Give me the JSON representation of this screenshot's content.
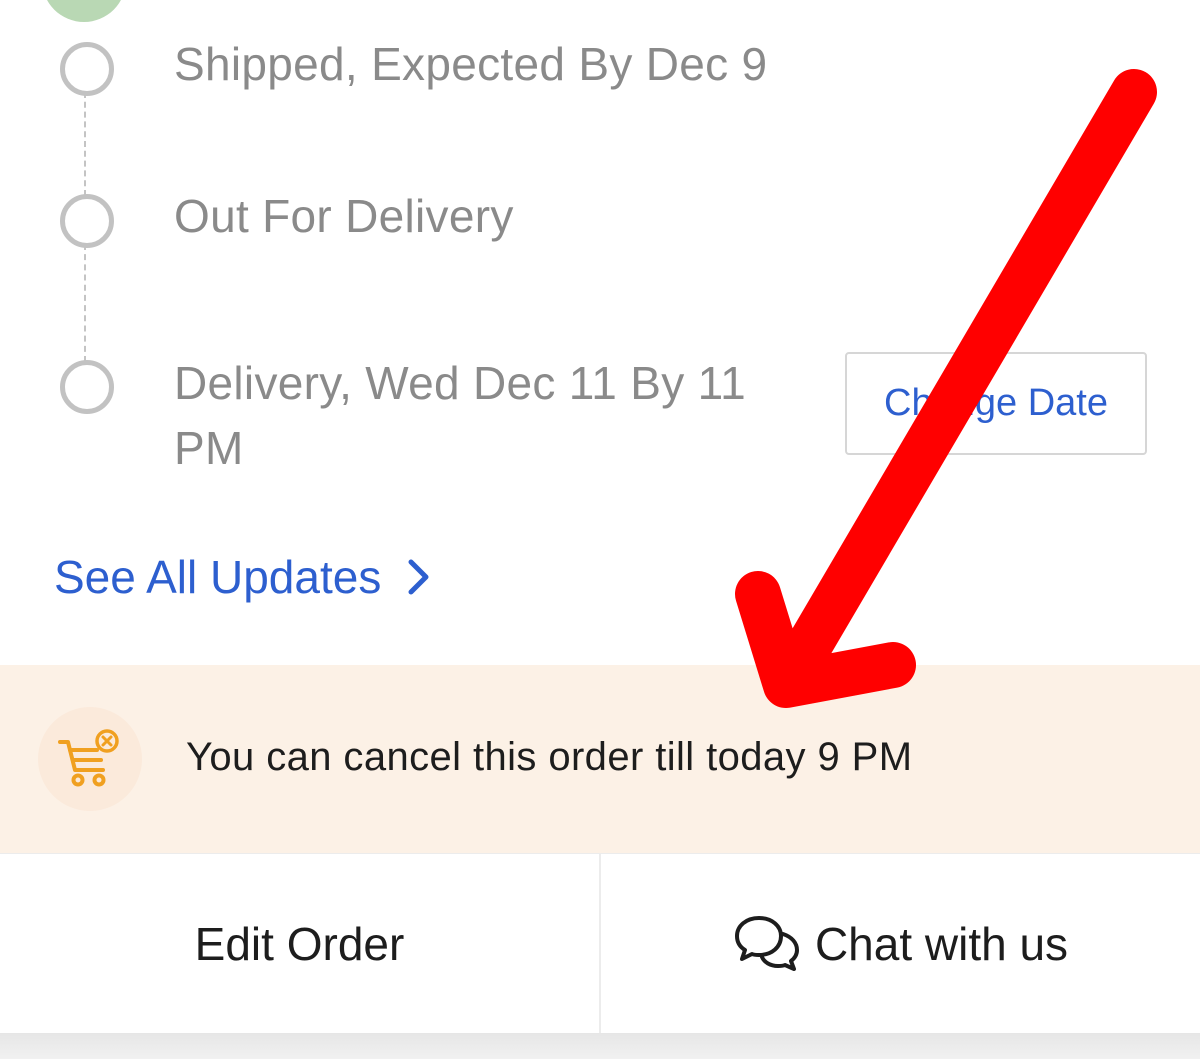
{
  "timeline": {
    "steps": [
      {
        "label": "Shipped, Expected By Dec 9"
      },
      {
        "label": "Out For Delivery"
      },
      {
        "label": "Delivery, Wed Dec 11 By 11",
        "label_line2": "PM"
      }
    ],
    "change_date_label": "Change Date",
    "see_all_label": "See All Updates"
  },
  "cancel_notice": {
    "text": "You can cancel this order till today 9 PM",
    "icon": "cart-cancel-icon"
  },
  "actions": {
    "edit_order_label": "Edit Order",
    "chat_label": "Chat with us"
  },
  "colors": {
    "link": "#2d5fcf",
    "banner_bg": "#fcf1e6",
    "cart_icon": "#f0a020",
    "annotation_arrow": "#ff0000",
    "step_inactive": "#c2c2c2"
  }
}
